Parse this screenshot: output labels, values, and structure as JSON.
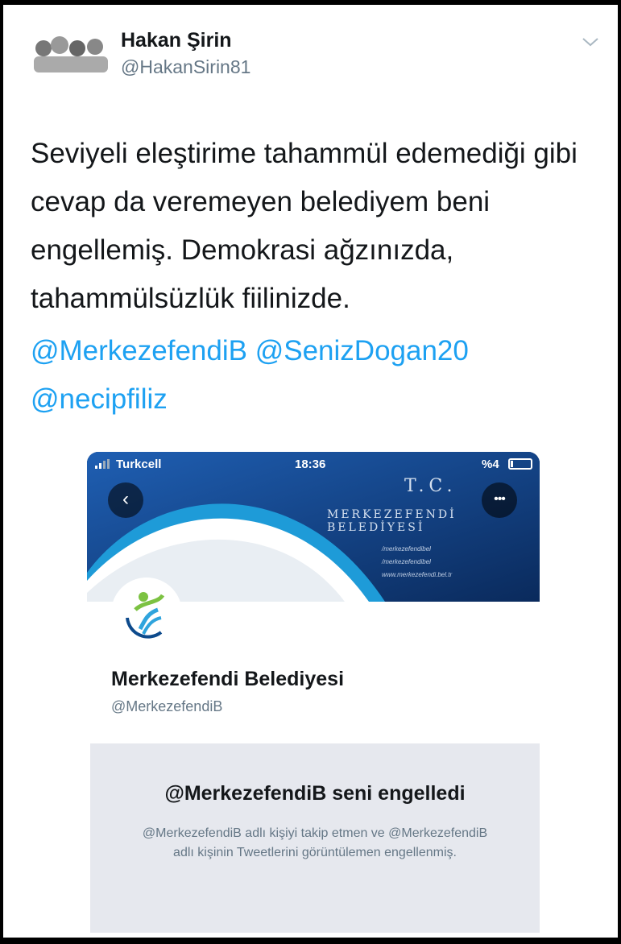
{
  "tweet": {
    "author_name": "Hakan Şirin",
    "author_handle": "@HakanSirin81",
    "icons": {
      "avatar": "avatar-group-photo",
      "menu": "chevron-down-icon"
    },
    "text": "Seviyeli eleştirime tahammül edemediği gibi cevap da veremeyen belediyem beni engellemiş. Demokrasi ağzınızda, tahammülsüzlük fiilinizde.",
    "mentions": [
      "@MerkezefendiB",
      "@SenizDogan20",
      "@necipfiliz"
    ]
  },
  "embedded_screenshot": {
    "status_bar": {
      "carrier": "Turkcell",
      "time": "18:36",
      "battery": "%4"
    },
    "cover": {
      "heading": "T.C.",
      "title": "MERKEZEFENDİ BELEDİYESİ",
      "social_lines": [
        "/merkezefendibel",
        "/merkezefendibel",
        "www.merkezefendi.bel.tr"
      ]
    },
    "profile": {
      "name": "Merkezefendi Belediyesi",
      "handle": "@MerkezefendiB"
    },
    "blocked": {
      "title": "@MerkezefendiB seni engelledi",
      "description": "@MerkezefendiB adlı kişiyi takip etmen ve @MerkezefendiB adlı kişinin Tweetlerini görüntülemen engellenmiş."
    }
  },
  "colors": {
    "link": "#1da1f2",
    "text": "#14171a",
    "muted": "#657786",
    "cover": "#0d2f63",
    "panel": "#e6e8ee"
  }
}
